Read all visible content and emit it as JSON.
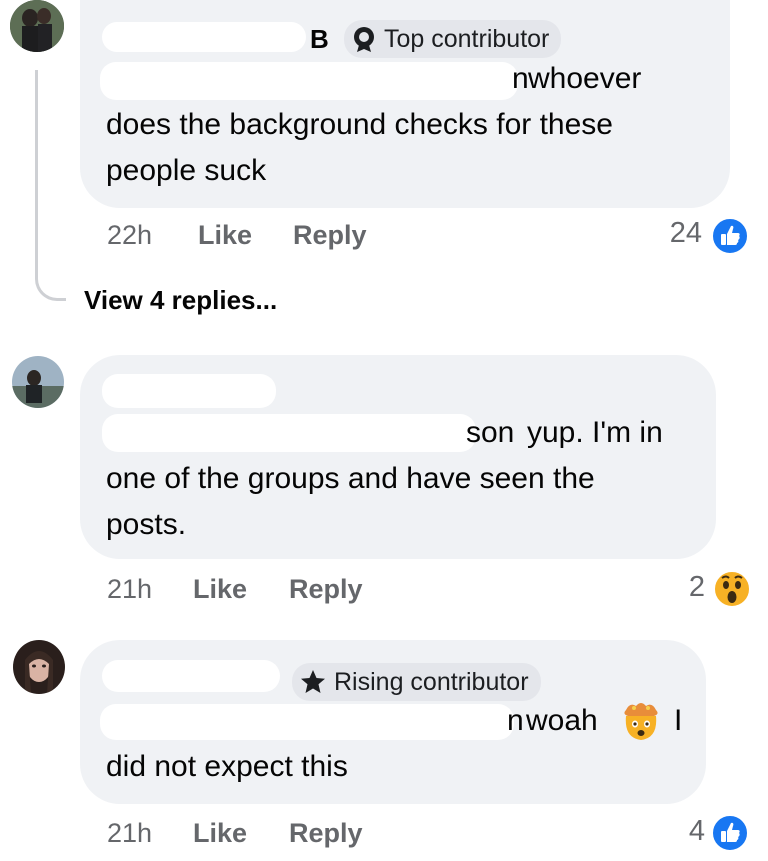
{
  "comments": [
    {
      "author_visible": "B",
      "badge": "Top contributor",
      "badge_icon": "top-contributor-icon",
      "mention_tail": "n",
      "lines": [
        "whoever",
        "does the background checks for these",
        "people suck"
      ],
      "time": "22h",
      "like": "Like",
      "reply": "Reply",
      "reaction_count": "24",
      "reaction_icon": "like-icon"
    },
    {
      "mention_tail": "son",
      "lines": [
        "yup. I'm in",
        "one of the groups and have seen the",
        "posts."
      ],
      "time": "21h",
      "like": "Like",
      "reply": "Reply",
      "reaction_count": "2",
      "reaction_icon": "wow-icon"
    },
    {
      "badge": "Rising contributor",
      "badge_icon": "star-icon",
      "mention_tail": "n",
      "lines": [
        "woah",
        "I",
        "did not expect this"
      ],
      "emoji_icon": "mind-blown-emoji-icon",
      "time": "21h",
      "like": "Like",
      "reply": "Reply",
      "reaction_count": "4",
      "reaction_icon": "like-icon"
    }
  ],
  "view_replies": "View 4 replies...",
  "colors": {
    "bubble": "#f0f2f5",
    "like_blue": "#1877f2",
    "meta_gray": "#65676b",
    "wow_yellow": "#f7b125"
  }
}
